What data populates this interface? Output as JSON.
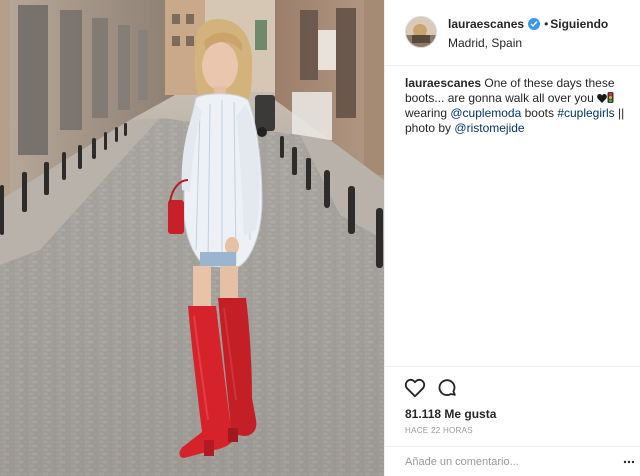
{
  "post": {
    "author": {
      "username": "lauraescanes",
      "verified": true,
      "separator": "•",
      "follow_status": "Siguiendo",
      "location": "Madrid, Spain"
    },
    "caption": {
      "username": "lauraescanes",
      "text_1": "One of these days these boots... are gonna walk all over you",
      "text_2": "wearing",
      "mention_1": "@cuplemoda",
      "text_3": "boots",
      "hashtag": "#cuplegirls",
      "text_4": "||",
      "text_5": "photo by",
      "mention_2": "@ristomejide"
    },
    "actions": {
      "like_icon": "heart-outline-icon",
      "comment_icon": "comment-bubble-icon"
    },
    "likes": "81.118 Me gusta",
    "timestamp": "HACE 22 HORAS",
    "comment_placeholder": "Añade un comentario...",
    "colors": {
      "link": "#003569",
      "verified": "#3897f0",
      "border": "#efefef",
      "muted": "#999999",
      "text": "#262626"
    }
  }
}
